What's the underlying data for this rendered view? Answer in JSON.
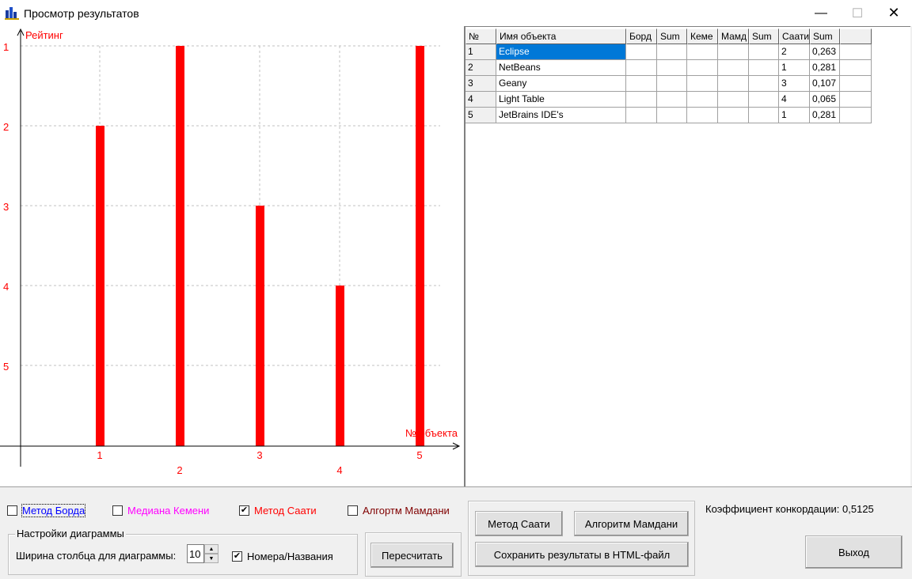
{
  "window": {
    "title": "Просмотр результатов",
    "minimize_glyph": "—",
    "maximize_glyph": "☐",
    "close_glyph": "✕"
  },
  "chart_data": {
    "type": "bar",
    "ylabel": "Рейтинг",
    "xlabel": "№ объекта",
    "categories": [
      "1",
      "2",
      "3",
      "4",
      "5"
    ],
    "values": [
      2,
      1,
      3,
      4,
      1
    ],
    "y_ticks": [
      "1",
      "2",
      "3",
      "4",
      "5"
    ],
    "y_axis_inverted": true,
    "ylim": [
      0,
      5
    ],
    "grid": true,
    "bar_color": "#ff0000",
    "text_color": "#ff0000"
  },
  "table": {
    "headers": [
      "№",
      "Имя объекта",
      "Борд",
      "Sum",
      "Кеме",
      "Мамд",
      "Sum",
      "Саати",
      "Sum",
      ""
    ],
    "rows": [
      [
        "1",
        "Eclipse",
        "",
        "",
        "",
        "",
        "",
        "2",
        "0,263",
        ""
      ],
      [
        "2",
        "NetBeans",
        "",
        "",
        "",
        "",
        "",
        "1",
        "0,281",
        ""
      ],
      [
        "3",
        "Geany",
        "",
        "",
        "",
        "",
        "",
        "3",
        "0,107",
        ""
      ],
      [
        "4",
        "Light Table",
        "",
        "",
        "",
        "",
        "",
        "4",
        "0,065",
        ""
      ],
      [
        "5",
        "JetBrains IDE's",
        "",
        "",
        "",
        "",
        "",
        "1",
        "0,281",
        ""
      ]
    ],
    "selected_row": 0
  },
  "methods": {
    "borda": {
      "label": "Метод Борда",
      "checked": false,
      "color": "#0000ff"
    },
    "kemeny": {
      "label": "Медиана Кемени",
      "checked": false,
      "color": "#ff00ff"
    },
    "saaty": {
      "label": "Метод Саати",
      "checked": true,
      "color": "#ff0000"
    },
    "mamdani": {
      "label": "Алгортм Мамдани",
      "checked": false,
      "color": "#800000"
    }
  },
  "diagram_settings": {
    "title": "Настройки диаграммы",
    "width_label": "Ширина столбца для диаграммы:",
    "width_value": "10",
    "numbers_label": "Номера/Названия",
    "numbers_checked": true
  },
  "buttons": {
    "recalc": "Пересчитать",
    "saaty": "Метод Саати",
    "mamdani": "Алгоритм Мамдани",
    "save_html": "Сохранить результаты в HTML-файл",
    "exit": "Выход"
  },
  "concordance": "Коэффициент конкордации: 0,5125"
}
